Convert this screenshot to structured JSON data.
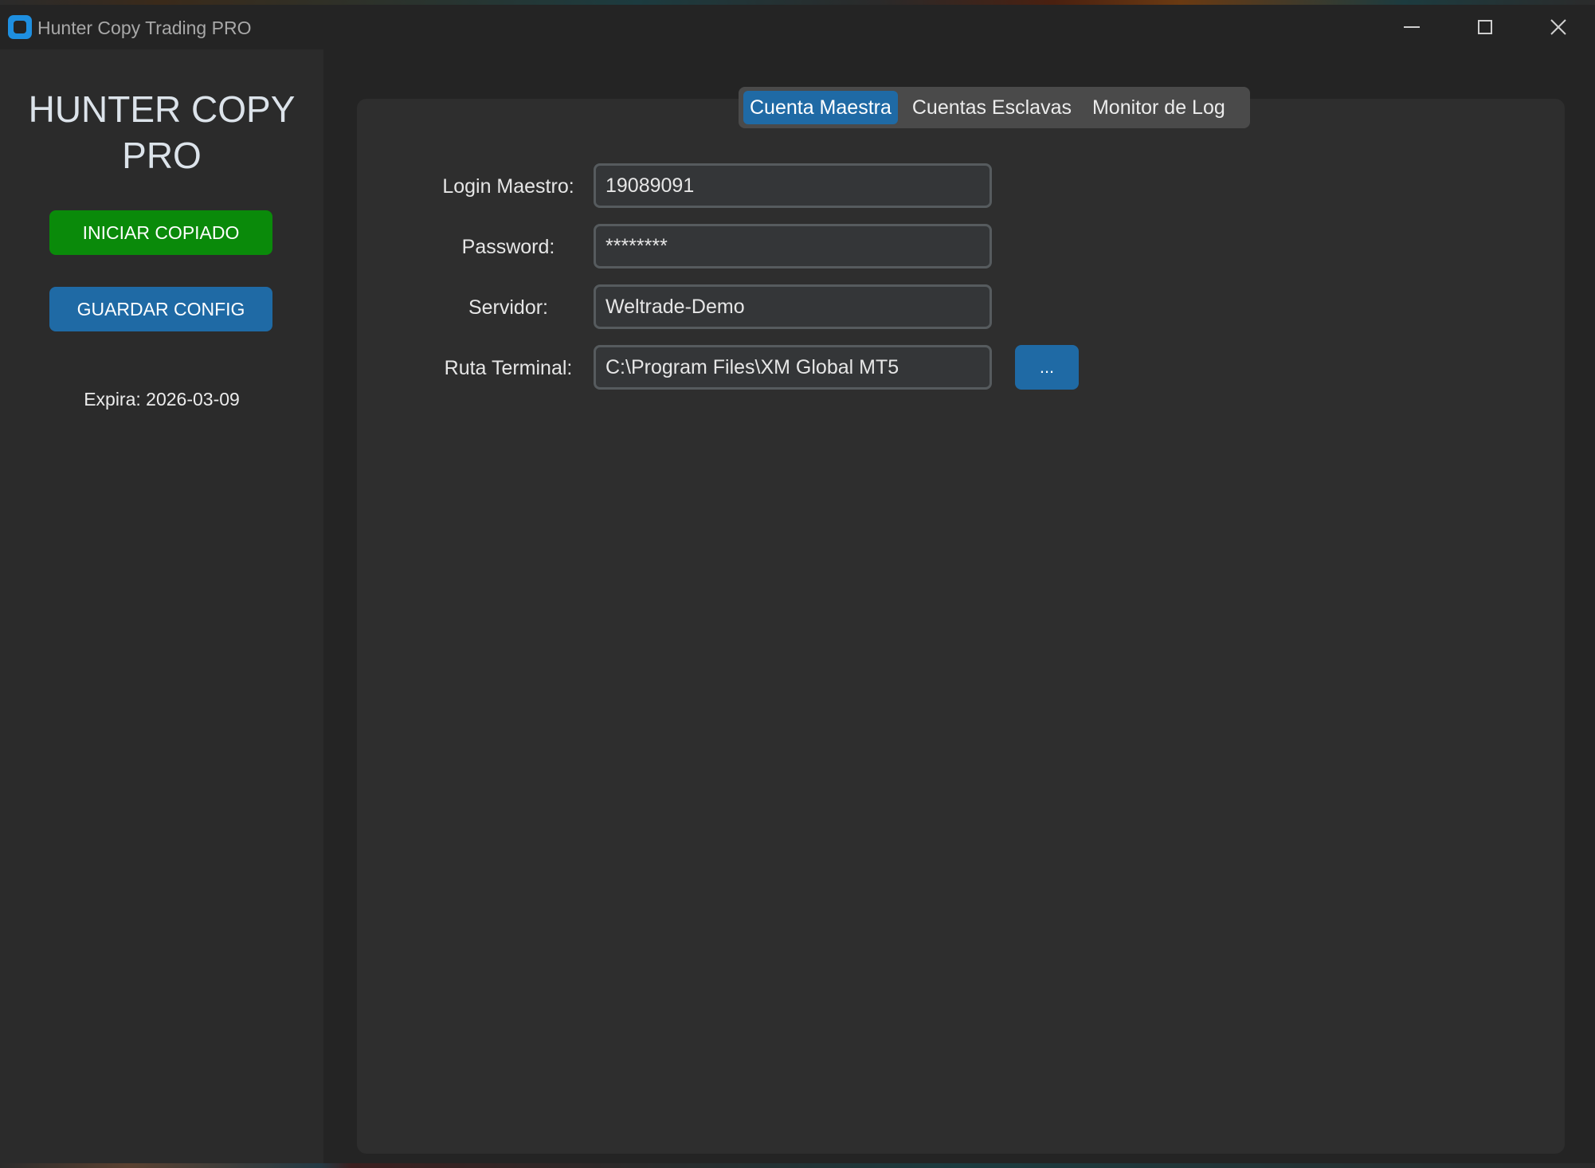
{
  "window": {
    "title": "Hunter Copy Trading PRO"
  },
  "sidebar": {
    "brand": "HUNTER COPY PRO",
    "start_button": "INICIAR COPIADO",
    "save_button": "GUARDAR CONFIG",
    "expiry": "Expira: 2026-03-09"
  },
  "tabs": [
    {
      "label": "Cuenta Maestra",
      "active": true
    },
    {
      "label": "Cuentas Esclavas",
      "active": false
    },
    {
      "label": "Monitor de Log",
      "active": false
    }
  ],
  "form": {
    "login": {
      "label": "Login Maestro:",
      "value": "19089091"
    },
    "password": {
      "label": "Password:",
      "value": "********"
    },
    "server": {
      "label": "Servidor:",
      "value": "Weltrade-Demo"
    },
    "terminal": {
      "label": "Ruta Terminal:",
      "value": "C:\\Program Files\\XM Global MT5"
    },
    "browse_button": "..."
  },
  "colors": {
    "accent": "#1f6aa5",
    "start_green": "#0a8a0a",
    "background": "#292929"
  }
}
